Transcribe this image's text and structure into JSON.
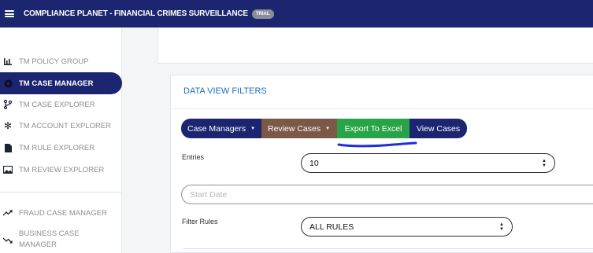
{
  "header": {
    "title": "COMPLIANCE PLANET - FINANCIAL CRIMES SURVEILLANCE",
    "badge": "TRIAL"
  },
  "sidebar": {
    "items": [
      {
        "label": "TM POLICY GROUP",
        "icon": "bar-chart-icon"
      },
      {
        "label": "TM CASE MANAGER",
        "icon": "gear-icon",
        "active": true
      },
      {
        "label": "TM CASE EXPLORER",
        "icon": "branch-icon"
      },
      {
        "label": "TM ACCOUNT EXPLORER",
        "icon": "snowflake-icon"
      },
      {
        "label": "TM RULE EXPLORER",
        "icon": "file-icon"
      },
      {
        "label": "TM REVIEW EXPLORER",
        "icon": "image-icon"
      },
      {
        "label": "FRAUD CASE MANAGER",
        "icon": "trend-up-icon"
      },
      {
        "label": "BUSINESS CASE MANAGER",
        "icon": "trend-down-icon"
      }
    ]
  },
  "filters": {
    "title": "DATA VIEW FILTERS",
    "buttons": {
      "case_managers": "Case Managers",
      "review_cases": "Review Cases",
      "export": "Export To Excel",
      "view_cases": "View Cases"
    },
    "entries_label": "Entries",
    "entries_value": "10",
    "start_date_placeholder": "Start Date",
    "filter_rules_label": "Filter Rules",
    "filter_rules_value": "ALL RULES"
  },
  "colors": {
    "navy": "#1b2570",
    "brown": "#7b5848",
    "green": "#27a448",
    "link": "#1d6fbf",
    "annotation": "#1f2fd6"
  }
}
